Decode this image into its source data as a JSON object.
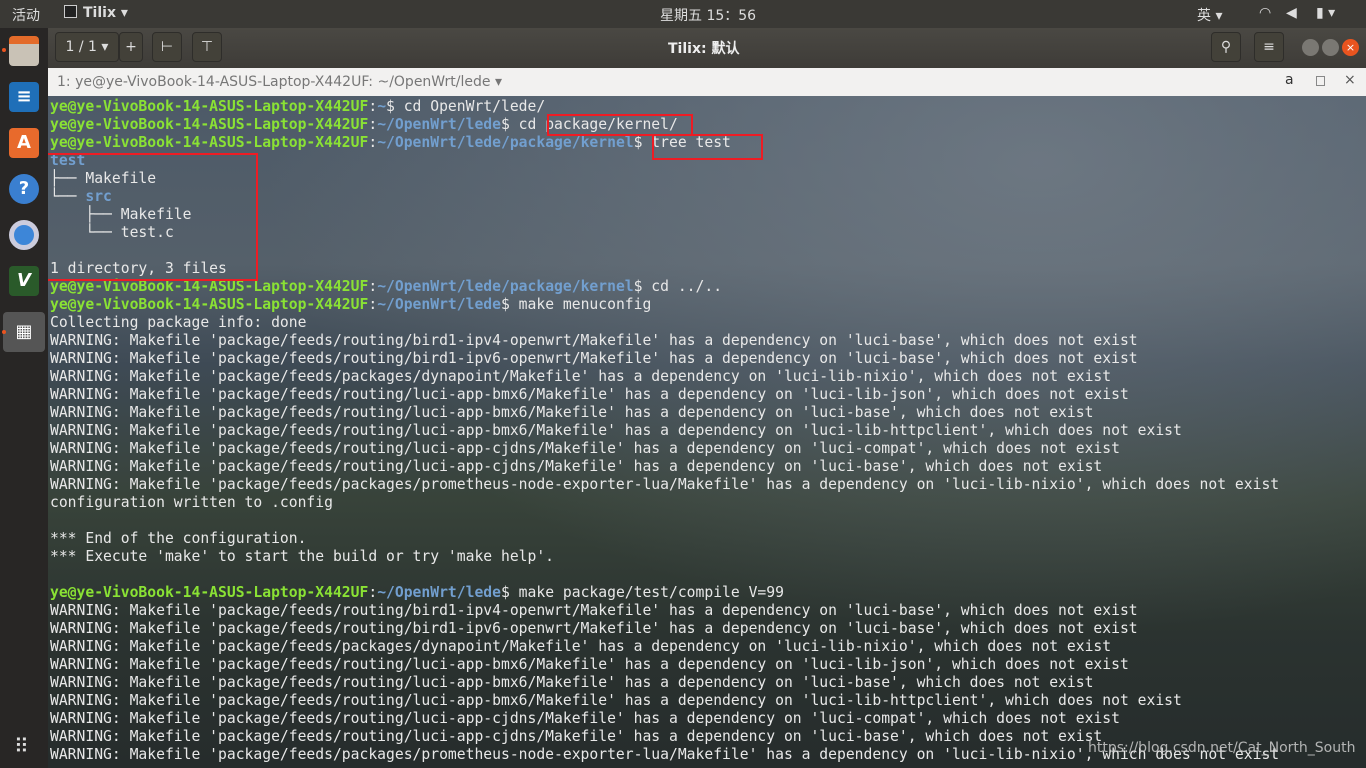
{
  "topbar": {
    "activities": "活动",
    "app": "Tilix ▾",
    "clock": "星期五 15：56",
    "ime": "英 ▾",
    "tray": [
      "wifi-icon",
      "volume-muted-icon",
      "battery-icon"
    ]
  },
  "dock": {
    "items": [
      "files-icon",
      "writer-icon",
      "software-center-icon",
      "help-icon",
      "chromium-icon",
      "vim-icon",
      "tilix-icon"
    ]
  },
  "titlebar": {
    "session": "1 / 1 ▾",
    "add": "+",
    "title": "Tilix: 默认"
  },
  "tabbar": {
    "title": "1: ye@ye-VivoBook-14-ASUS-Laptop-X442UF: ~/OpenWrt/lede ▾"
  },
  "terminal": {
    "user": "ye@ye-VivoBook-14-ASUS-Laptop-X442UF",
    "lines": [
      {
        "type": "prompt",
        "path": "~",
        "cmd": " cd OpenWrt/lede/"
      },
      {
        "type": "prompt",
        "path": "~/OpenWrt/lede",
        "cmd": " cd package/kernel/"
      },
      {
        "type": "prompt",
        "path": "~/OpenWrt/lede/package/kernel",
        "cmd": " tree test"
      },
      {
        "type": "dir",
        "pre": "",
        "name": "test"
      },
      {
        "type": "text",
        "text": "├── Makefile"
      },
      {
        "type": "dir",
        "pre": "└── ",
        "name": "src"
      },
      {
        "type": "text",
        "text": "    ├── Makefile"
      },
      {
        "type": "text",
        "text": "    └── test.c"
      },
      {
        "type": "text",
        "text": ""
      },
      {
        "type": "text",
        "text": "1 directory, 3 files"
      },
      {
        "type": "prompt",
        "path": "~/OpenWrt/lede/package/kernel",
        "cmd": " cd ../.."
      },
      {
        "type": "prompt",
        "path": "~/OpenWrt/lede",
        "cmd": " make menuconfig"
      },
      {
        "type": "text",
        "text": "Collecting package info: done"
      },
      {
        "type": "text",
        "text": "WARNING: Makefile 'package/feeds/routing/bird1-ipv4-openwrt/Makefile' has a dependency on 'luci-base', which does not exist"
      },
      {
        "type": "text",
        "text": "WARNING: Makefile 'package/feeds/routing/bird1-ipv6-openwrt/Makefile' has a dependency on 'luci-base', which does not exist"
      },
      {
        "type": "text",
        "text": "WARNING: Makefile 'package/feeds/packages/dynapoint/Makefile' has a dependency on 'luci-lib-nixio', which does not exist"
      },
      {
        "type": "text",
        "text": "WARNING: Makefile 'package/feeds/routing/luci-app-bmx6/Makefile' has a dependency on 'luci-lib-json', which does not exist"
      },
      {
        "type": "text",
        "text": "WARNING: Makefile 'package/feeds/routing/luci-app-bmx6/Makefile' has a dependency on 'luci-base', which does not exist"
      },
      {
        "type": "text",
        "text": "WARNING: Makefile 'package/feeds/routing/luci-app-bmx6/Makefile' has a dependency on 'luci-lib-httpclient', which does not exist"
      },
      {
        "type": "text",
        "text": "WARNING: Makefile 'package/feeds/routing/luci-app-cjdns/Makefile' has a dependency on 'luci-compat', which does not exist"
      },
      {
        "type": "text",
        "text": "WARNING: Makefile 'package/feeds/routing/luci-app-cjdns/Makefile' has a dependency on 'luci-base', which does not exist"
      },
      {
        "type": "text",
        "text": "WARNING: Makefile 'package/feeds/packages/prometheus-node-exporter-lua/Makefile' has a dependency on 'luci-lib-nixio', which does not exist"
      },
      {
        "type": "text",
        "text": "configuration written to .config"
      },
      {
        "type": "text",
        "text": ""
      },
      {
        "type": "text",
        "text": "*** End of the configuration."
      },
      {
        "type": "text",
        "text": "*** Execute 'make' to start the build or try 'make help'."
      },
      {
        "type": "text",
        "text": ""
      },
      {
        "type": "prompt",
        "path": "~/OpenWrt/lede",
        "cmd": " make package/test/compile V=99"
      },
      {
        "type": "text",
        "text": "WARNING: Makefile 'package/feeds/routing/bird1-ipv4-openwrt/Makefile' has a dependency on 'luci-base', which does not exist"
      },
      {
        "type": "text",
        "text": "WARNING: Makefile 'package/feeds/routing/bird1-ipv6-openwrt/Makefile' has a dependency on 'luci-base', which does not exist"
      },
      {
        "type": "text",
        "text": "WARNING: Makefile 'package/feeds/packages/dynapoint/Makefile' has a dependency on 'luci-lib-nixio', which does not exist"
      },
      {
        "type": "text",
        "text": "WARNING: Makefile 'package/feeds/routing/luci-app-bmx6/Makefile' has a dependency on 'luci-lib-json', which does not exist"
      },
      {
        "type": "text",
        "text": "WARNING: Makefile 'package/feeds/routing/luci-app-bmx6/Makefile' has a dependency on 'luci-base', which does not exist"
      },
      {
        "type": "text",
        "text": "WARNING: Makefile 'package/feeds/routing/luci-app-bmx6/Makefile' has a dependency on 'luci-lib-httpclient', which does not exist"
      },
      {
        "type": "text",
        "text": "WARNING: Makefile 'package/feeds/routing/luci-app-cjdns/Makefile' has a dependency on 'luci-compat', which does not exist"
      },
      {
        "type": "text",
        "text": "WARNING: Makefile 'package/feeds/routing/luci-app-cjdns/Makefile' has a dependency on 'luci-base', which does not exist"
      },
      {
        "type": "text",
        "text": "WARNING: Makefile 'package/feeds/packages/prometheus-node-exporter-lua/Makefile' has a dependency on 'luci-lib-nixio', which does not exist"
      }
    ]
  },
  "watermark": "https://blog.csdn.net/Cat_North_South",
  "colors": {
    "user": "#8ae234",
    "path": "#729fcf",
    "highlight": "#ee1c24"
  }
}
